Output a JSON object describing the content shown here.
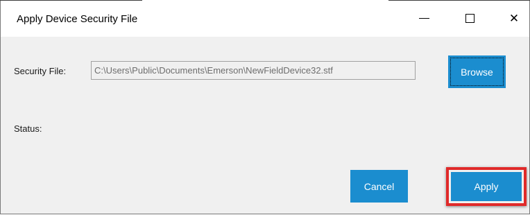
{
  "window": {
    "title": "Apply Device Security File",
    "controls": {
      "minimize": "minimize-icon",
      "maximize": "maximize-icon",
      "close": "close-icon",
      "close_glyph": "✕"
    }
  },
  "form": {
    "security_file_label": "Security File:",
    "security_file_value": "C:\\Users\\Public\\Documents\\Emerson\\NewFieldDevice32.stf",
    "browse_label": "Browse",
    "status_label": "Status:"
  },
  "actions": {
    "cancel_label": "Cancel",
    "apply_label": "Apply"
  },
  "colors": {
    "button_blue": "#1b8dcf",
    "highlight_red": "#e02a2a",
    "client_bg": "#f0f0f0"
  }
}
